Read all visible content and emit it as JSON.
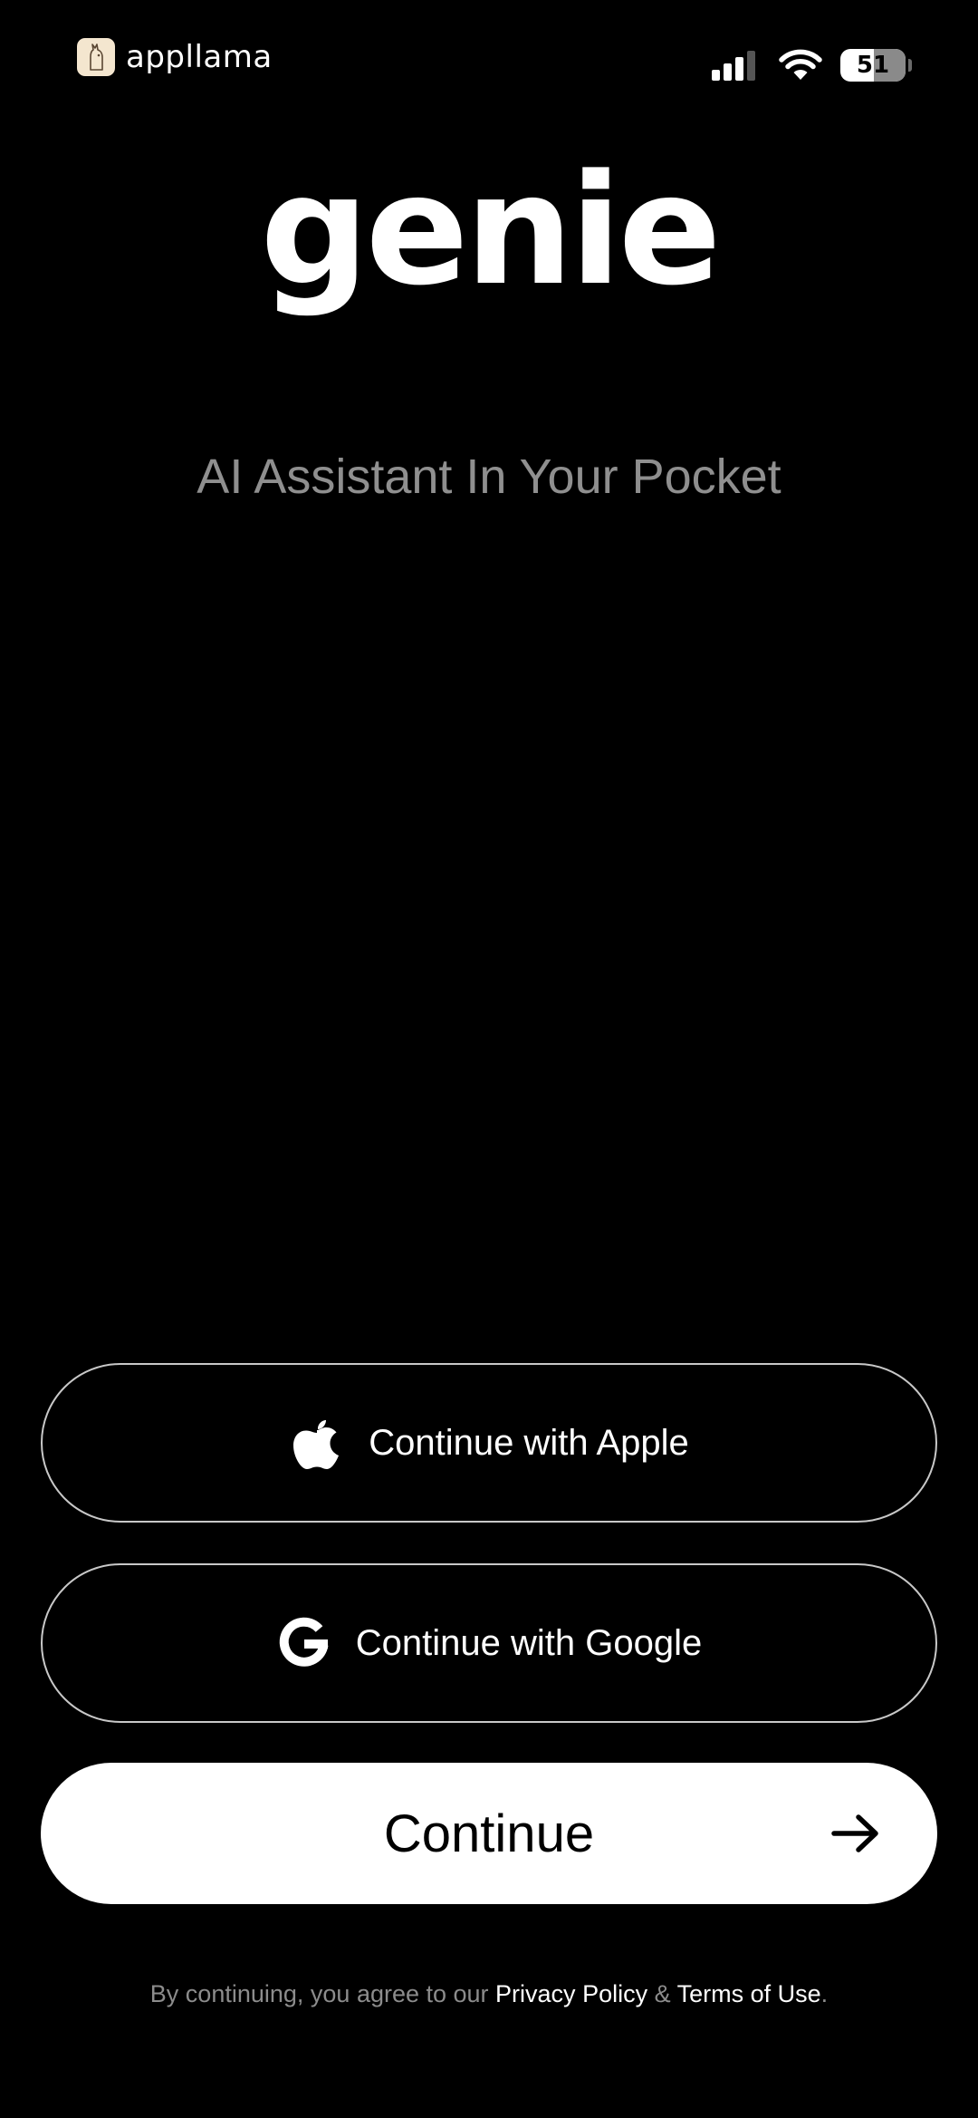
{
  "status_bar": {
    "brand_name": "appllama",
    "battery_level": "51",
    "signal_bars_active": 3,
    "signal_bars_total": 4
  },
  "hero": {
    "title": "genie",
    "tagline": "AI Assistant In Your Pocket"
  },
  "buttons": {
    "apple": {
      "label": "Continue with Apple",
      "icon": "apple-logo-icon"
    },
    "google": {
      "label": "Continue with Google",
      "icon": "google-logo-icon"
    },
    "continue": {
      "label": "Continue",
      "icon": "arrow-right-icon"
    }
  },
  "legal": {
    "prefix": "By continuing, you agree to our ",
    "privacy_link": "Privacy Policy",
    "separator": " & ",
    "terms_link": "Terms of Use",
    "suffix": "."
  },
  "colors": {
    "background": "#000000",
    "primary_text": "#ffffff",
    "muted_text": "#8f8f8f",
    "outline": "#c8c8c8",
    "primary_button": "#ffffff"
  }
}
